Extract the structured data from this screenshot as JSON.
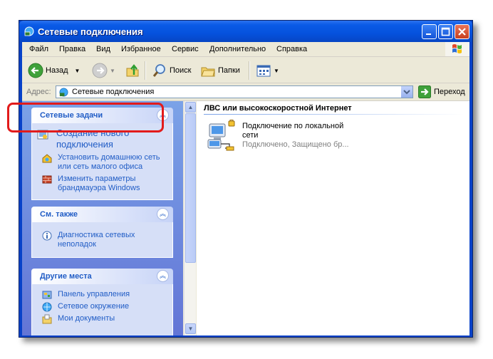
{
  "window": {
    "title": "Сетевые подключения"
  },
  "menu": [
    "Файл",
    "Правка",
    "Вид",
    "Избранное",
    "Сервис",
    "Дополнительно",
    "Справка"
  ],
  "toolbar": {
    "back": "Назад",
    "search": "Поиск",
    "folders": "Папки"
  },
  "address": {
    "label": "Адрес:",
    "value": "Сетевые подключения",
    "go": "Переход"
  },
  "network_tasks": {
    "title": "Сетевые задачи",
    "items": [
      "Создание нового подключения",
      "Установить домашнюю сеть или сеть малого офиса",
      "Изменить параметры брандмауэра Windows"
    ]
  },
  "see_also": {
    "title": "См. также",
    "items": [
      "Диагностика сетевых неполадок"
    ]
  },
  "other_places": {
    "title": "Другие места",
    "items": [
      "Панель управления",
      "Сетевое окружение",
      "Мои документы"
    ]
  },
  "content": {
    "group": "ЛВС или высокоскоростной Интернет",
    "connection_name": "Подключение по локальной сети",
    "connection_status": "Подключено, Защищено бр..."
  }
}
